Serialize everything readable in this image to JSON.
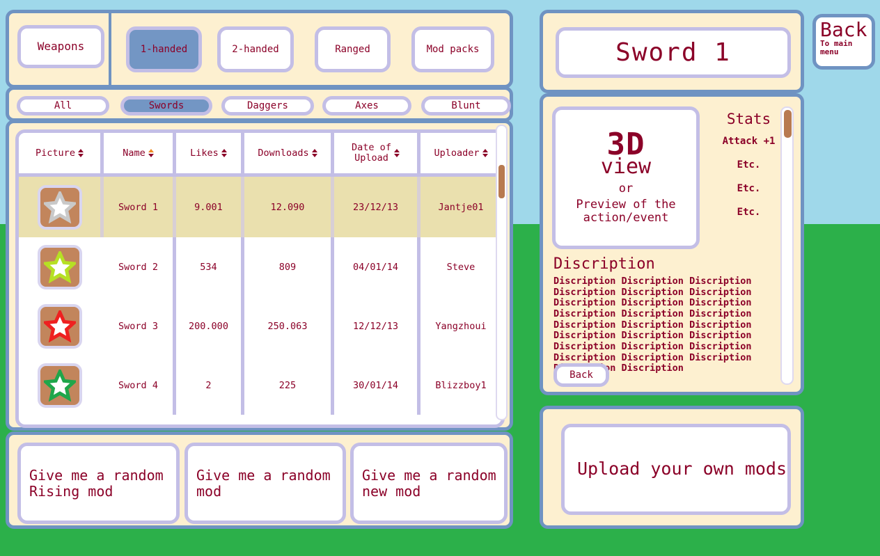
{
  "background": {
    "sky_color": "#9fd8ea",
    "ground_color": "#2cb04a"
  },
  "theme": {
    "panel_bg": "#fdf0d0",
    "panel_border": "#6f93c2",
    "button_border": "#c3bee6",
    "button_bg": "#ffffff",
    "active_button_bg": "#7396c4",
    "text_color": "#8b0128",
    "selected_row_bg": "#eae0ae",
    "thumb_bg": "#c2855c",
    "scrollbar_thumb": "#b87a50",
    "sort_active_color": "#ef8a22"
  },
  "left_top": {
    "section_label": "Weapons",
    "categories": [
      {
        "label": "1-handed",
        "active": true
      },
      {
        "label": "2-handed",
        "active": false
      },
      {
        "label": "Ranged",
        "active": false
      },
      {
        "label": "Mod packs",
        "active": false
      }
    ]
  },
  "left_subtabs": [
    {
      "label": "All",
      "active": false
    },
    {
      "label": "Swords",
      "active": true
    },
    {
      "label": "Daggers",
      "active": false
    },
    {
      "label": "Axes",
      "active": false
    },
    {
      "label": "Blunt",
      "active": false
    }
  ],
  "table": {
    "columns": [
      {
        "label": "Picture",
        "sort": "none"
      },
      {
        "label": "Name",
        "sort": "asc"
      },
      {
        "label": "Likes",
        "sort": "none"
      },
      {
        "label": "Downloads",
        "sort": "none"
      },
      {
        "label": "Date of\nUpload",
        "sort": "none"
      },
      {
        "label": "Uploader",
        "sort": "none"
      }
    ],
    "rows": [
      {
        "star_color": "#c9c9c9",
        "name": "Sword 1",
        "likes": "9.001",
        "downloads": "12.090",
        "date": "23/12/13",
        "uploader": "Jantje01",
        "selected": true
      },
      {
        "star_color": "#b6e024",
        "name": "Sword 2",
        "likes": "534",
        "downloads": "809",
        "date": "04/01/14",
        "uploader": "Steve",
        "selected": false
      },
      {
        "star_color": "#ee2020",
        "name": "Sword 3",
        "likes": "200.000",
        "downloads": "250.063",
        "date": "12/12/13",
        "uploader": "Yangzhoui",
        "selected": false
      },
      {
        "star_color": "#1fa64a",
        "name": "Sword 4",
        "likes": "2",
        "downloads": "225",
        "date": "30/01/14",
        "uploader": "Blizzboy1",
        "selected": false
      }
    ],
    "scrollbar": {
      "icon": "vertical-scrollbar"
    }
  },
  "random_buttons": [
    {
      "label": "Give me a random Rising mod"
    },
    {
      "label": "Give me a random mod"
    },
    {
      "label": "Give me a random new mod"
    }
  ],
  "detail": {
    "title": "Sword 1",
    "preview": {
      "line1": "3D",
      "line2": "view",
      "line3": "or",
      "line4": "Preview of the action/event"
    },
    "stats_title": "Stats",
    "stats": [
      "Attack +1",
      "Etc.",
      "Etc.",
      "Etc."
    ],
    "description_title": "Discription",
    "description_body": "Discription Discription Discription\nDiscription Discription Discription\nDiscription Discription Discription\nDiscription Discription Discription\nDiscription Discription Discription\nDiscription Discription Discription\nDiscription Discription Discription\nDiscription Discription Discription\nDiscription Discription",
    "back_label": "Back"
  },
  "upload": {
    "label": "Upload your own mods"
  },
  "back_main": {
    "big": "Back",
    "small": "To main menu"
  }
}
